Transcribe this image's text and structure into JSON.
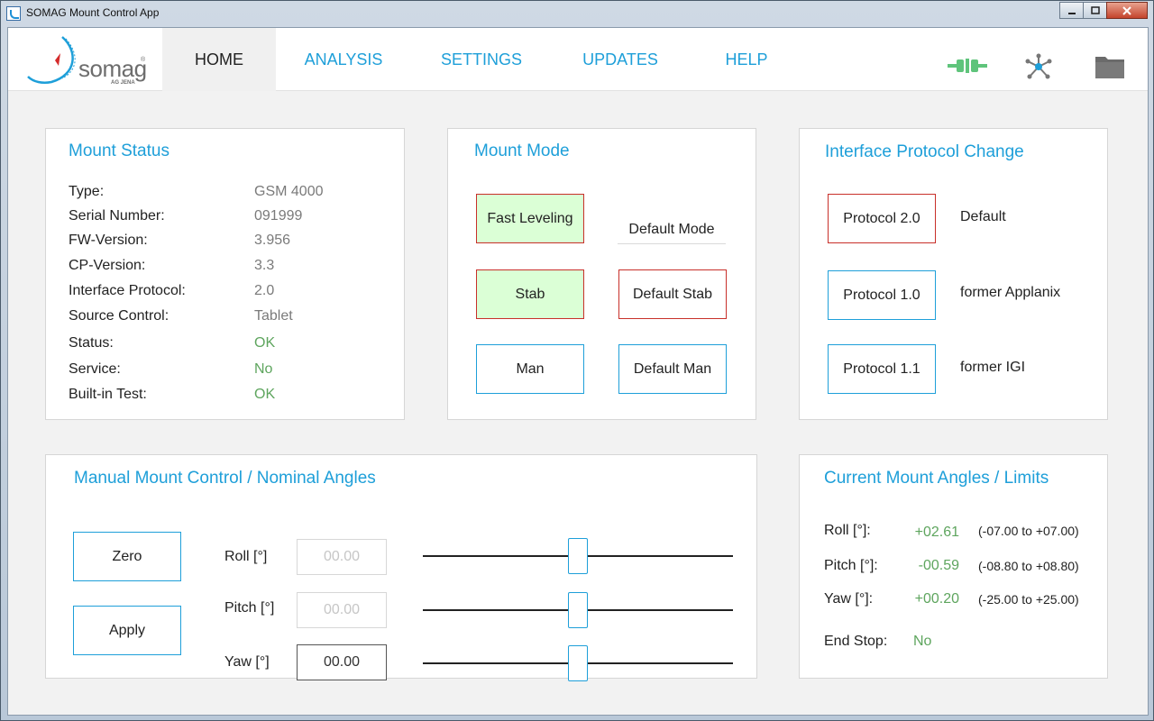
{
  "window": {
    "title": "SOMAG Mount Control App"
  },
  "logo": {
    "brand": "somag",
    "sub": "AG JENA",
    "reg": "®"
  },
  "nav": {
    "items": [
      {
        "label": "HOME"
      },
      {
        "label": "ANALYSIS"
      },
      {
        "label": "SETTINGS"
      },
      {
        "label": "UPDATES"
      },
      {
        "label": "HELP"
      }
    ],
    "active": "HOME"
  },
  "header_icons": [
    "connection-plug-icon",
    "network-icon",
    "folder-icon"
  ],
  "colors": {
    "accent": "#1e9fd9",
    "ok_green": "#5ea55e",
    "active_green_bg": "#dbffd6",
    "alert_red": "#c8302a"
  },
  "mount_status": {
    "title": "Mount Status",
    "rows": [
      {
        "label": "Type:",
        "value": "GSM 4000"
      },
      {
        "label": "Serial Number:",
        "value": "091999"
      },
      {
        "label": "FW-Version:",
        "value": "3.956"
      },
      {
        "label": "CP-Version:",
        "value": "3.3"
      },
      {
        "label": "Interface Protocol:",
        "value": "2.0"
      },
      {
        "label": "Source Control:",
        "value": "Tablet"
      },
      {
        "label": "Status:",
        "value": "OK"
      },
      {
        "label": "Service:",
        "value": "No"
      },
      {
        "label": "Built-in Test:",
        "value": "OK"
      }
    ]
  },
  "mount_mode": {
    "title": "Mount Mode",
    "fast_leveling": "Fast Leveling",
    "default_mode_label": "Default Mode",
    "stab": "Stab",
    "default_stab": "Default Stab",
    "man": "Man",
    "default_man": "Default Man"
  },
  "protocol": {
    "title": "Interface Protocol Change",
    "rows": [
      {
        "button": "Protocol 2.0",
        "desc": "Default"
      },
      {
        "button": "Protocol 1.0",
        "desc": "former Applanix"
      },
      {
        "button": "Protocol 1.1",
        "desc": "former IGI"
      }
    ]
  },
  "manual": {
    "title": "Manual Mount Control / Nominal Angles",
    "zero": "Zero",
    "apply": "Apply",
    "axes": [
      {
        "label": "Roll [°]",
        "value": "00.00",
        "enabled": false,
        "slider_fraction": 0.5
      },
      {
        "label": "Pitch [°]",
        "value": "00.00",
        "enabled": false,
        "slider_fraction": 0.5
      },
      {
        "label": "Yaw [°]",
        "value": "00.00",
        "enabled": true,
        "slider_fraction": 0.5
      }
    ]
  },
  "current": {
    "title": "Current Mount Angles / Limits",
    "rows": [
      {
        "label": "Roll [°]:",
        "value": "+02.61",
        "limits": "(-07.00 to +07.00)"
      },
      {
        "label": "Pitch [°]:",
        "value": "-00.59",
        "limits": "(-08.80 to +08.80)"
      },
      {
        "label": "Yaw [°]:",
        "value": "+00.20",
        "limits": "(-25.00 to +25.00)"
      }
    ],
    "end_stop_label": "End Stop:",
    "end_stop_value": "No"
  }
}
